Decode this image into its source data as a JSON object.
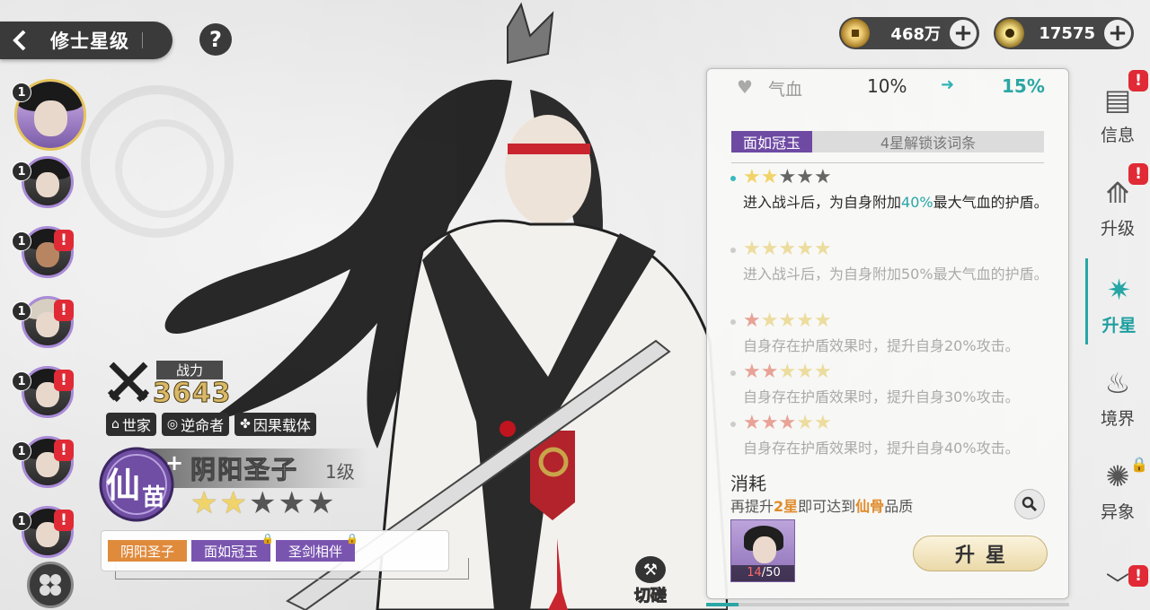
{
  "header": {
    "title": "修士星级",
    "help_label": "?"
  },
  "currency": [
    {
      "icon": "copper-coin-icon",
      "value": "468万",
      "plus": "+"
    },
    {
      "icon": "spirit-gem-icon",
      "value": "17575",
      "plus": "+"
    }
  ],
  "roster": [
    {
      "level": "1",
      "alert": "",
      "selected": true
    },
    {
      "level": "1",
      "alert": ""
    },
    {
      "level": "1",
      "alert": "!"
    },
    {
      "level": "1",
      "alert": "!"
    },
    {
      "level": "1",
      "alert": "!"
    },
    {
      "level": "1",
      "alert": "!"
    },
    {
      "level": "1",
      "alert": "!"
    }
  ],
  "power": {
    "label": "战力",
    "value": "3643"
  },
  "traits": [
    {
      "icon": "clan-icon",
      "label": "世家"
    },
    {
      "icon": "swirl-icon",
      "label": "逆命者"
    },
    {
      "icon": "triskelion-icon",
      "label": "因果载体"
    }
  ],
  "character": {
    "grade": "仙",
    "grade_sub": "苗",
    "grade_plus": "+",
    "name": "阴阳圣子",
    "level": "1级",
    "stars_lit": 2,
    "stars_total": 5
  },
  "skills": [
    {
      "label": "阴阳圣子",
      "color": "#e08a3c",
      "locked": false
    },
    {
      "label": "面如冠玉",
      "color": "#7a55b0",
      "locked": true
    },
    {
      "label": "圣剑相伴",
      "color": "#7a55b0",
      "locked": true
    }
  ],
  "spar": {
    "label": "切磋"
  },
  "panel": {
    "stat": {
      "name": "气血",
      "from": "10%",
      "arrow": "➜",
      "to": "15%"
    },
    "affix": {
      "name": "面如冠玉",
      "condition": "4星解锁该词条"
    },
    "tiers": [
      {
        "stars": "gg kkk",
        "desc_pre": "进入战斗后，为自身附加",
        "desc_hl": "40%",
        "desc_post": "最大气血的护盾。",
        "active": true
      },
      {
        "stars": "ppppp",
        "desc_pre": "进入战斗后，为自身附加50%最大气血的护盾。",
        "desc_hl": "",
        "desc_post": "",
        "active": false
      },
      {
        "stars": "rpppp",
        "desc_pre": "自身存在护盾效果时，提升自身20%攻击。",
        "desc_hl": "",
        "desc_post": "",
        "active": false
      },
      {
        "stars": "rrppp",
        "desc_pre": "自身存在护盾效果时，提升自身30%攻击。",
        "desc_hl": "",
        "desc_post": "",
        "active": false
      },
      {
        "stars": "rrrpp",
        "desc_pre": "自身存在护盾效果时，提升自身40%攻击。",
        "desc_hl": "",
        "desc_post": "",
        "active": false
      }
    ],
    "consume": {
      "title": "消耗",
      "hint_a": "再提升",
      "hint_b": "2星",
      "hint_c": "即可达到",
      "hint_d": "仙骨",
      "hint_e": "品质",
      "owned": "14",
      "need": "50"
    },
    "upstar_label": "升星"
  },
  "nav": [
    {
      "icon": "scroll-icon",
      "label": "信息",
      "alert": "!",
      "active": false,
      "locked": false
    },
    {
      "icon": "upgrade-icon",
      "label": "升级",
      "alert": "!",
      "active": false,
      "locked": false
    },
    {
      "icon": "star-sigil-icon",
      "label": "升星",
      "alert": "",
      "active": true,
      "locked": false
    },
    {
      "icon": "flame-icon",
      "label": "境界",
      "alert": "",
      "active": false,
      "locked": false
    },
    {
      "icon": "orbit-icon",
      "label": "异象",
      "alert": "",
      "active": false,
      "locked": true
    }
  ],
  "nav_more_alert": "!",
  "colors": {
    "accent": "#27a6a6",
    "purple": "#6e4aa3",
    "gold": "#f0d46a",
    "alert": "#e02a35"
  }
}
